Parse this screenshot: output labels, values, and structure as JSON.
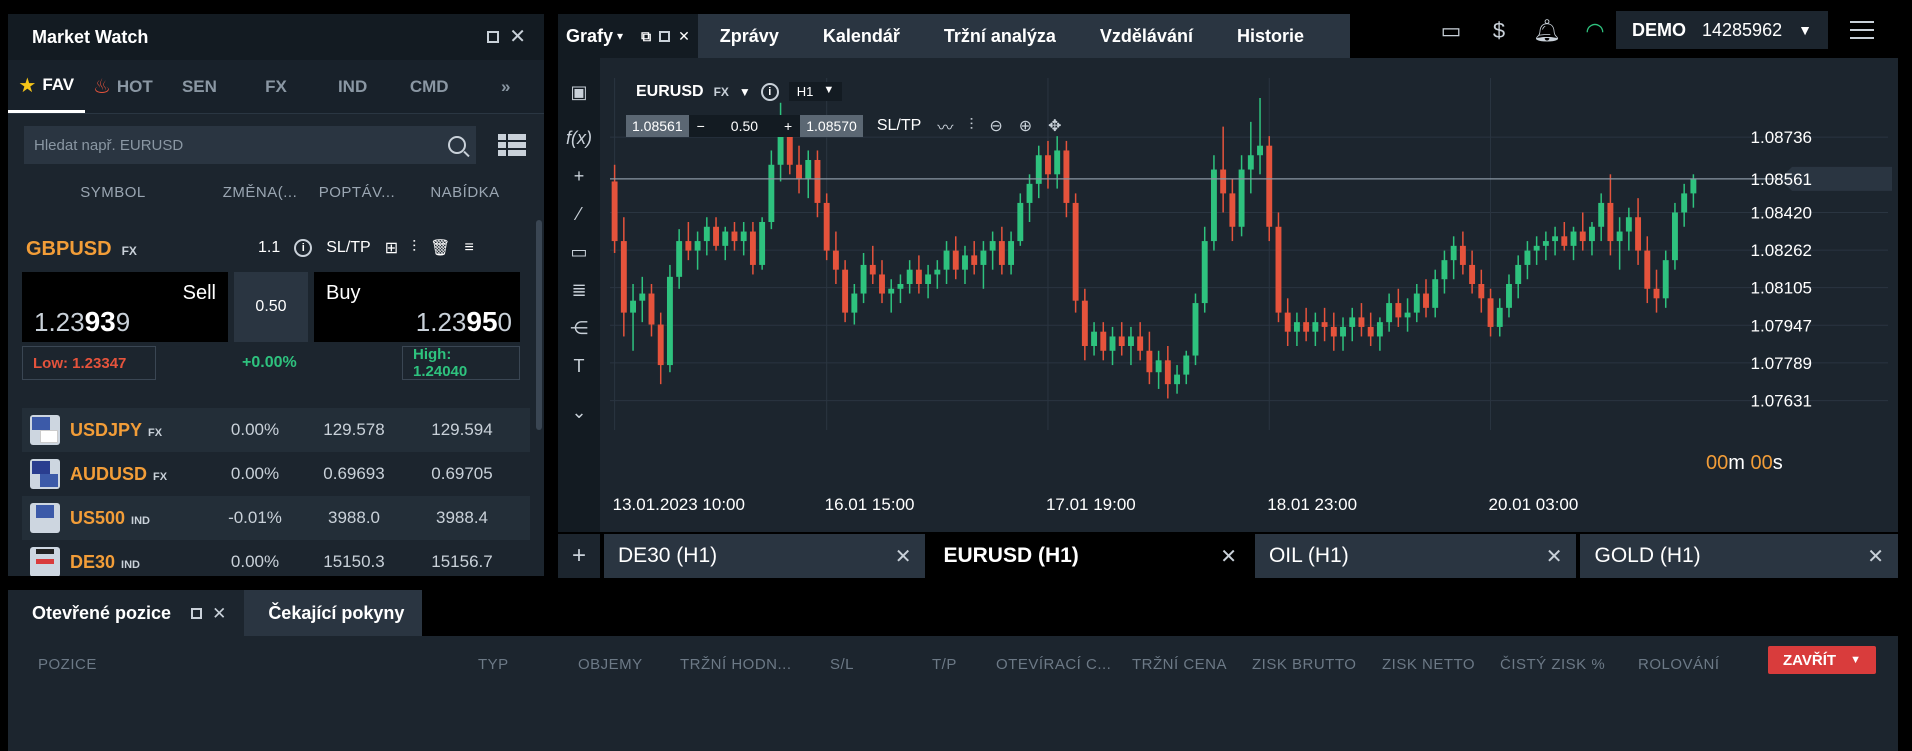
{
  "market_watch": {
    "title": "Market Watch",
    "categories": [
      "FAV",
      "HOT",
      "SEN",
      "FX",
      "IND",
      "CMD"
    ],
    "search_placeholder": "Hledat např. EURUSD",
    "columns": [
      "SYMBOL",
      "ZMĚNA(...",
      "POPTÁV...",
      "NABÍDKA"
    ],
    "featured": {
      "symbol": "GBPUSD",
      "tag": "FX",
      "volume_small": "1.1",
      "sltp": "SL/TP",
      "sell_label": "Sell",
      "sell_price_pre": "1.23",
      "sell_price_big": "93",
      "sell_price_post": "9",
      "buy_label": "Buy",
      "buy_price_pre": "1.23",
      "buy_price_big": "95",
      "buy_price_post": "0",
      "volume": "0.50",
      "low": "Low: 1.23347",
      "high": "High: 1.24040",
      "change": "+0.00%"
    },
    "rows": [
      {
        "symbol": "USDJPY",
        "tag": "FX",
        "change": "0.00%",
        "bid": "129.578",
        "ask": "129.594"
      },
      {
        "symbol": "AUDUSD",
        "tag": "FX",
        "change": "0.00%",
        "bid": "0.69693",
        "ask": "0.69705"
      },
      {
        "symbol": "US500",
        "tag": "IND",
        "change": "-0.01%",
        "bid": "3988.0",
        "ask": "3988.4"
      },
      {
        "symbol": "DE30",
        "tag": "IND",
        "change": "0.00%",
        "bid": "15150.3",
        "ask": "15156.7"
      }
    ]
  },
  "nav": {
    "charts": "Grafy",
    "items": [
      "Zprávy",
      "Kalendář",
      "Tržní analýza",
      "Vzdělávání",
      "Historie"
    ]
  },
  "account": {
    "mode": "DEMO",
    "number": "14285962"
  },
  "chart": {
    "pair": "EURUSD",
    "tag": "FX",
    "timeframe": "H1",
    "bid": "1.08561",
    "volume": "0.50",
    "ask": "1.08570",
    "sltp": "SL/TP",
    "timer_m": "00",
    "timer_m_unit": "m",
    "timer_s": "00",
    "timer_s_unit": "s",
    "y_labels": [
      "1.08736",
      "1.08420",
      "1.08262",
      "1.08105",
      "1.07947",
      "1.07789",
      "1.07631"
    ],
    "current_price": "1.08561",
    "x_labels": [
      "13.01.2023 10:00",
      "16.01 15:00",
      "17.01 19:00",
      "18.01 23:00",
      "20.01 03:00"
    ]
  },
  "chart_tabs": [
    "DE30 (H1)",
    "EURUSD (H1)",
    "OIL (H1)",
    "GOLD (H1)"
  ],
  "bottom": {
    "tab_open": "Otevřené pozice",
    "tab_pending": "Čekající pokyny",
    "columns": [
      "POZICE",
      "TYP",
      "OBJEMY",
      "TRŽNÍ HODN...",
      "S/L",
      "T/P",
      "OTEVÍRACÍ C...",
      "TRŽNÍ CENA",
      "ZISK BRUTTO",
      "ZISK NETTO",
      "ČISTÝ ZISK %",
      "ROLOVÁNÍ"
    ],
    "close_button": "ZAVŘÍT"
  },
  "chart_data": {
    "type": "candlestick",
    "ylim": [
      1.076,
      1.089
    ],
    "y_ticks": [
      1.08736,
      1.0842,
      1.08262,
      1.08105,
      1.07947,
      1.07789,
      1.07631
    ],
    "current_price": 1.08561,
    "x_ticks": [
      "13.01.2023 10:00",
      "16.01 15:00",
      "17.01 19:00",
      "18.01 23:00",
      "20.01 03:00"
    ],
    "colors": {
      "up": "#2ec27e",
      "down": "#e5533c",
      "grid": "#2a3541",
      "price_line": "#8a97a3"
    },
    "candles": [
      [
        1.0855,
        1.0862,
        1.0825,
        1.083
      ],
      [
        1.083,
        1.084,
        1.079,
        1.08
      ],
      [
        1.08,
        1.0812,
        1.0784,
        1.0805
      ],
      [
        1.0805,
        1.0815,
        1.0796,
        1.0808
      ],
      [
        1.0808,
        1.0812,
        1.079,
        1.0795
      ],
      [
        1.0795,
        1.08,
        1.077,
        1.0778
      ],
      [
        1.0778,
        1.082,
        1.0775,
        1.0815
      ],
      [
        1.0815,
        1.0835,
        1.081,
        1.083
      ],
      [
        1.083,
        1.0838,
        1.0822,
        1.0826
      ],
      [
        1.0826,
        1.0834,
        1.0818,
        1.083
      ],
      [
        1.083,
        1.084,
        1.0824,
        1.0836
      ],
      [
        1.0836,
        1.084,
        1.0826,
        1.0828
      ],
      [
        1.0828,
        1.0836,
        1.0822,
        1.0834
      ],
      [
        1.0834,
        1.0838,
        1.0826,
        1.083
      ],
      [
        1.083,
        1.0838,
        1.0824,
        1.0834
      ],
      [
        1.0834,
        1.0838,
        1.0816,
        1.082
      ],
      [
        1.082,
        1.084,
        1.0818,
        1.0838
      ],
      [
        1.0838,
        1.0868,
        1.0835,
        1.0862
      ],
      [
        1.0862,
        1.0888,
        1.0855,
        1.0875
      ],
      [
        1.0875,
        1.088,
        1.0858,
        1.0862
      ],
      [
        1.0862,
        1.087,
        1.085,
        1.0856
      ],
      [
        1.0856,
        1.0868,
        1.0848,
        1.0864
      ],
      [
        1.0864,
        1.0868,
        1.084,
        1.0846
      ],
      [
        1.0846,
        1.085,
        1.0822,
        1.0826
      ],
      [
        1.0826,
        1.0834,
        1.0812,
        1.0818
      ],
      [
        1.0818,
        1.0822,
        1.0796,
        1.08
      ],
      [
        1.08,
        1.0812,
        1.0795,
        1.0808
      ],
      [
        1.0808,
        1.0825,
        1.0804,
        1.082
      ],
      [
        1.082,
        1.0828,
        1.0812,
        1.0816
      ],
      [
        1.0816,
        1.0822,
        1.0804,
        1.0808
      ],
      [
        1.0808,
        1.0814,
        1.08,
        1.081
      ],
      [
        1.081,
        1.0816,
        1.0804,
        1.0812
      ],
      [
        1.0812,
        1.0822,
        1.0808,
        1.0818
      ],
      [
        1.0818,
        1.0824,
        1.0808,
        1.0812
      ],
      [
        1.0812,
        1.082,
        1.0806,
        1.0816
      ],
      [
        1.0816,
        1.0822,
        1.081,
        1.0818
      ],
      [
        1.0818,
        1.083,
        1.0812,
        1.0826
      ],
      [
        1.0826,
        1.0832,
        1.0814,
        1.0818
      ],
      [
        1.0818,
        1.0828,
        1.0812,
        1.0824
      ],
      [
        1.0824,
        1.083,
        1.0816,
        1.082
      ],
      [
        1.082,
        1.083,
        1.081,
        1.0826
      ],
      [
        1.0826,
        1.0834,
        1.0818,
        1.083
      ],
      [
        1.083,
        1.0836,
        1.0816,
        1.082
      ],
      [
        1.082,
        1.0834,
        1.0816,
        1.083
      ],
      [
        1.083,
        1.085,
        1.0828,
        1.0846
      ],
      [
        1.0846,
        1.0858,
        1.0838,
        1.0854
      ],
      [
        1.0854,
        1.087,
        1.0848,
        1.0866
      ],
      [
        1.0866,
        1.0872,
        1.0852,
        1.0858
      ],
      [
        1.0858,
        1.0874,
        1.0852,
        1.0868
      ],
      [
        1.0868,
        1.0872,
        1.084,
        1.0846
      ],
      [
        1.0846,
        1.085,
        1.08,
        1.0805
      ],
      [
        1.0805,
        1.081,
        1.078,
        1.0786
      ],
      [
        1.0786,
        1.0796,
        1.0782,
        1.0792
      ],
      [
        1.0792,
        1.0796,
        1.078,
        1.0784
      ],
      [
        1.0784,
        1.0794,
        1.0778,
        1.079
      ],
      [
        1.079,
        1.0796,
        1.0782,
        1.0786
      ],
      [
        1.0786,
        1.0794,
        1.0778,
        1.079
      ],
      [
        1.079,
        1.0796,
        1.078,
        1.0784
      ],
      [
        1.0784,
        1.0792,
        1.077,
        1.0775
      ],
      [
        1.0775,
        1.0784,
        1.0768,
        1.078
      ],
      [
        1.078,
        1.0786,
        1.0764,
        1.077
      ],
      [
        1.077,
        1.0778,
        1.0766,
        1.0774
      ],
      [
        1.0774,
        1.0784,
        1.077,
        1.0782
      ],
      [
        1.0782,
        1.0808,
        1.0778,
        1.0804
      ],
      [
        1.0804,
        1.0836,
        1.08,
        1.083
      ],
      [
        1.083,
        1.0866,
        1.0826,
        1.086
      ],
      [
        1.086,
        1.0878,
        1.0842,
        1.085
      ],
      [
        1.085,
        1.0856,
        1.083,
        1.0836
      ],
      [
        1.0836,
        1.0866,
        1.0832,
        1.086
      ],
      [
        1.086,
        1.088,
        1.085,
        1.0866
      ],
      [
        1.0866,
        1.089,
        1.0858,
        1.087
      ],
      [
        1.087,
        1.0874,
        1.083,
        1.0836
      ],
      [
        1.0836,
        1.0842,
        1.0796,
        1.08
      ],
      [
        1.08,
        1.0806,
        1.0786,
        1.0792
      ],
      [
        1.0792,
        1.08,
        1.0786,
        1.0796
      ],
      [
        1.0796,
        1.0802,
        1.0788,
        1.0792
      ],
      [
        1.0792,
        1.08,
        1.0786,
        1.0796
      ],
      [
        1.0796,
        1.0802,
        1.0788,
        1.0794
      ],
      [
        1.0794,
        1.08,
        1.0784,
        1.079
      ],
      [
        1.079,
        1.0798,
        1.0784,
        1.0794
      ],
      [
        1.0794,
        1.0802,
        1.0788,
        1.0798
      ],
      [
        1.0798,
        1.0804,
        1.079,
        1.0794
      ],
      [
        1.0794,
        1.08,
        1.0786,
        1.079
      ],
      [
        1.079,
        1.0798,
        1.0784,
        1.0796
      ],
      [
        1.0796,
        1.0808,
        1.0792,
        1.0804
      ],
      [
        1.0804,
        1.081,
        1.0794,
        1.0798
      ],
      [
        1.0798,
        1.0806,
        1.0792,
        1.08
      ],
      [
        1.08,
        1.0812,
        1.0796,
        1.0808
      ],
      [
        1.0808,
        1.0814,
        1.0798,
        1.0802
      ],
      [
        1.0802,
        1.0818,
        1.0798,
        1.0814
      ],
      [
        1.0814,
        1.0826,
        1.0808,
        1.0822
      ],
      [
        1.0822,
        1.0832,
        1.0814,
        1.0828
      ],
      [
        1.0828,
        1.0834,
        1.0816,
        1.082
      ],
      [
        1.082,
        1.0826,
        1.0808,
        1.0812
      ],
      [
        1.0812,
        1.0818,
        1.08,
        1.0806
      ],
      [
        1.0806,
        1.081,
        1.079,
        1.0794
      ],
      [
        1.0794,
        1.0806,
        1.079,
        1.0802
      ],
      [
        1.0802,
        1.0816,
        1.0798,
        1.0812
      ],
      [
        1.0812,
        1.0824,
        1.0806,
        1.082
      ],
      [
        1.082,
        1.083,
        1.0814,
        1.0826
      ],
      [
        1.0826,
        1.0832,
        1.082,
        1.0828
      ],
      [
        1.0828,
        1.0834,
        1.0822,
        1.083
      ],
      [
        1.083,
        1.0836,
        1.0824,
        1.0832
      ],
      [
        1.0832,
        1.0838,
        1.0826,
        1.0828
      ],
      [
        1.0828,
        1.0836,
        1.0822,
        1.0834
      ],
      [
        1.0834,
        1.0842,
        1.0826,
        1.083
      ],
      [
        1.083,
        1.0838,
        1.0824,
        1.0836
      ],
      [
        1.0836,
        1.085,
        1.083,
        1.0846
      ],
      [
        1.0846,
        1.0858,
        1.0824,
        1.083
      ],
      [
        1.083,
        1.084,
        1.0818,
        1.0834
      ],
      [
        1.0834,
        1.0844,
        1.0826,
        1.084
      ],
      [
        1.084,
        1.0848,
        1.082,
        1.0826
      ],
      [
        1.0826,
        1.0832,
        1.0804,
        1.081
      ],
      [
        1.081,
        1.0818,
        1.08,
        1.0806
      ],
      [
        1.0806,
        1.0826,
        1.0802,
        1.0822
      ],
      [
        1.0822,
        1.0846,
        1.0818,
        1.0842
      ],
      [
        1.0842,
        1.0854,
        1.0836,
        1.085
      ],
      [
        1.085,
        1.0858,
        1.0844,
        1.0856
      ]
    ]
  }
}
